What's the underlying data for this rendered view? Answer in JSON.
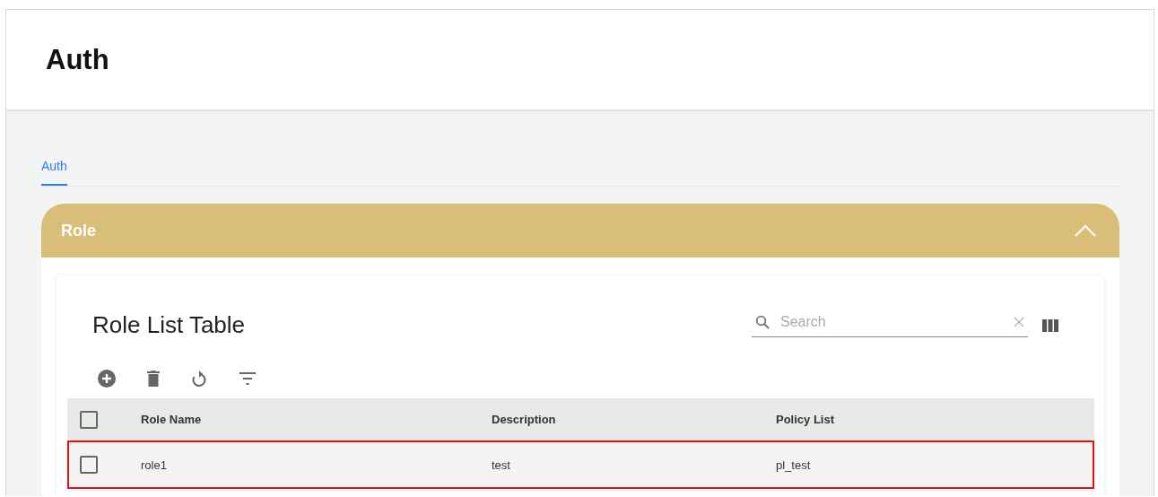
{
  "header": {
    "title": "Auth"
  },
  "tabs": [
    {
      "label": "Auth",
      "selected": true
    }
  ],
  "panel": {
    "title": "Role",
    "expanded": true
  },
  "table": {
    "title": "Role List Table",
    "search": {
      "placeholder": "Search"
    },
    "columns": [
      "Role Name",
      "Description",
      "Policy List"
    ],
    "select_all_checked": false,
    "rows": [
      {
        "cells": [
          "role1",
          "test",
          "pl_test"
        ],
        "checked": false,
        "highlighted": true
      }
    ]
  }
}
